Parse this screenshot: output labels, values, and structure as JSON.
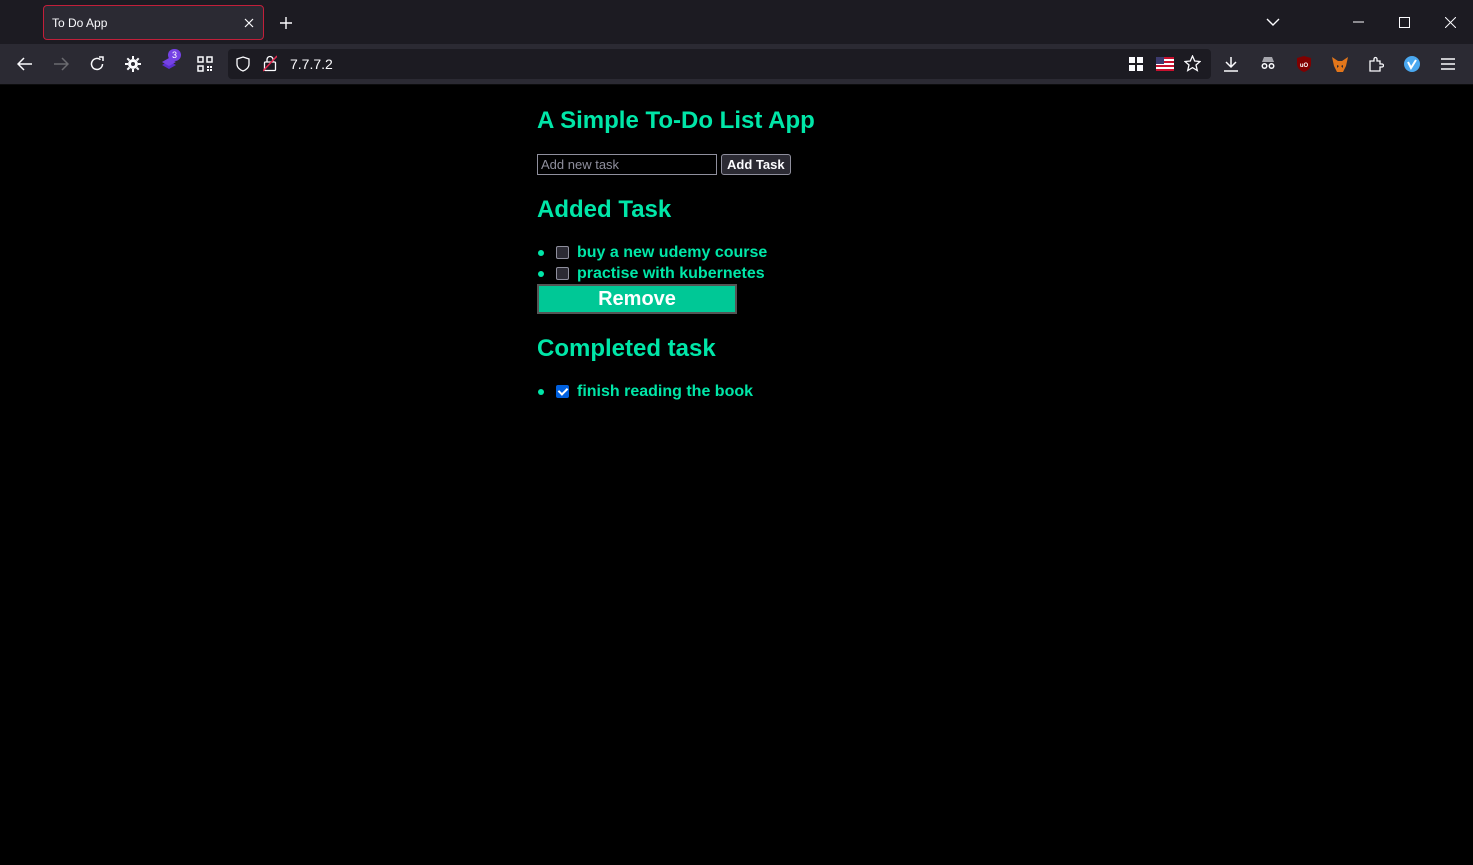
{
  "browser": {
    "tab_title": "To Do App",
    "url": "7.7.7.2",
    "extension_badge": "3"
  },
  "app": {
    "title": "A Simple To-Do List App",
    "input_placeholder": "Add new task",
    "add_button_label": "Add Task",
    "added_heading": "Added Task",
    "added_tasks": [
      {
        "label": "buy a new udemy course",
        "checked": false
      },
      {
        "label": "practise with kubernetes",
        "checked": false
      }
    ],
    "remove_button_label": "Remove",
    "completed_heading": "Completed task",
    "completed_tasks": [
      {
        "label": "finish reading the book",
        "checked": true
      }
    ]
  },
  "colors": {
    "accent": "#00e6a8",
    "remove_button": "#00c896",
    "background": "#000000"
  }
}
